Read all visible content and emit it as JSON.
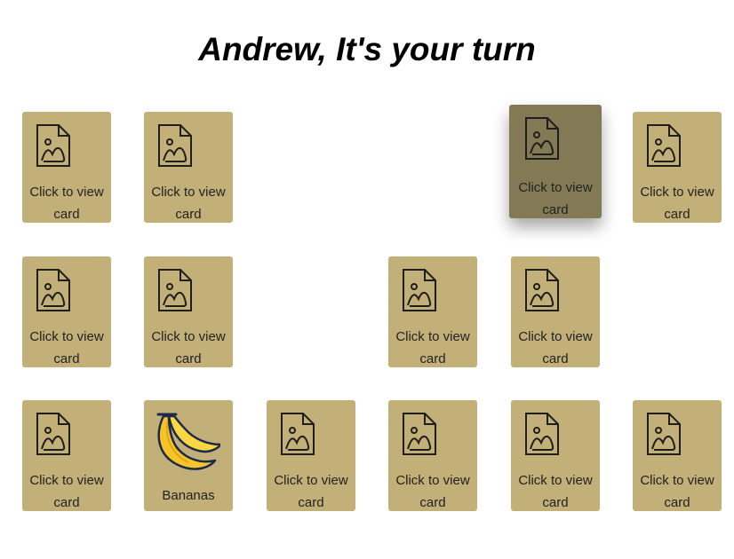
{
  "title": "Andrew, It's your turn",
  "colors": {
    "card_face_down": "#c2b078",
    "card_hover": "#837a55",
    "icon_stroke": "#1e1e1e"
  },
  "cards": [
    {
      "state": "hidden",
      "label": "Click to view card"
    },
    {
      "state": "hidden",
      "label": "Click to view card"
    },
    {
      "state": "hidden",
      "label": "Click to view card"
    },
    {
      "state": "hidden",
      "label": "Click to view card"
    },
    {
      "state": "hidden",
      "label": "Click to view card"
    },
    {
      "state": "hidden",
      "label": "Click to view card"
    },
    {
      "state": "hidden",
      "label": "Click to view card"
    },
    {
      "state": "hidden",
      "label": "Click to view card"
    },
    {
      "state": "hidden",
      "label": "Click to view card"
    },
    {
      "state": "revealed",
      "label": "Bananas",
      "icon": "banana-icon"
    },
    {
      "state": "hidden",
      "label": "Click to view card"
    },
    {
      "state": "hidden",
      "label": "Click to view card"
    },
    {
      "state": "hidden",
      "label": "Click to view card"
    },
    {
      "state": "hidden",
      "label": "Click to view card"
    }
  ]
}
